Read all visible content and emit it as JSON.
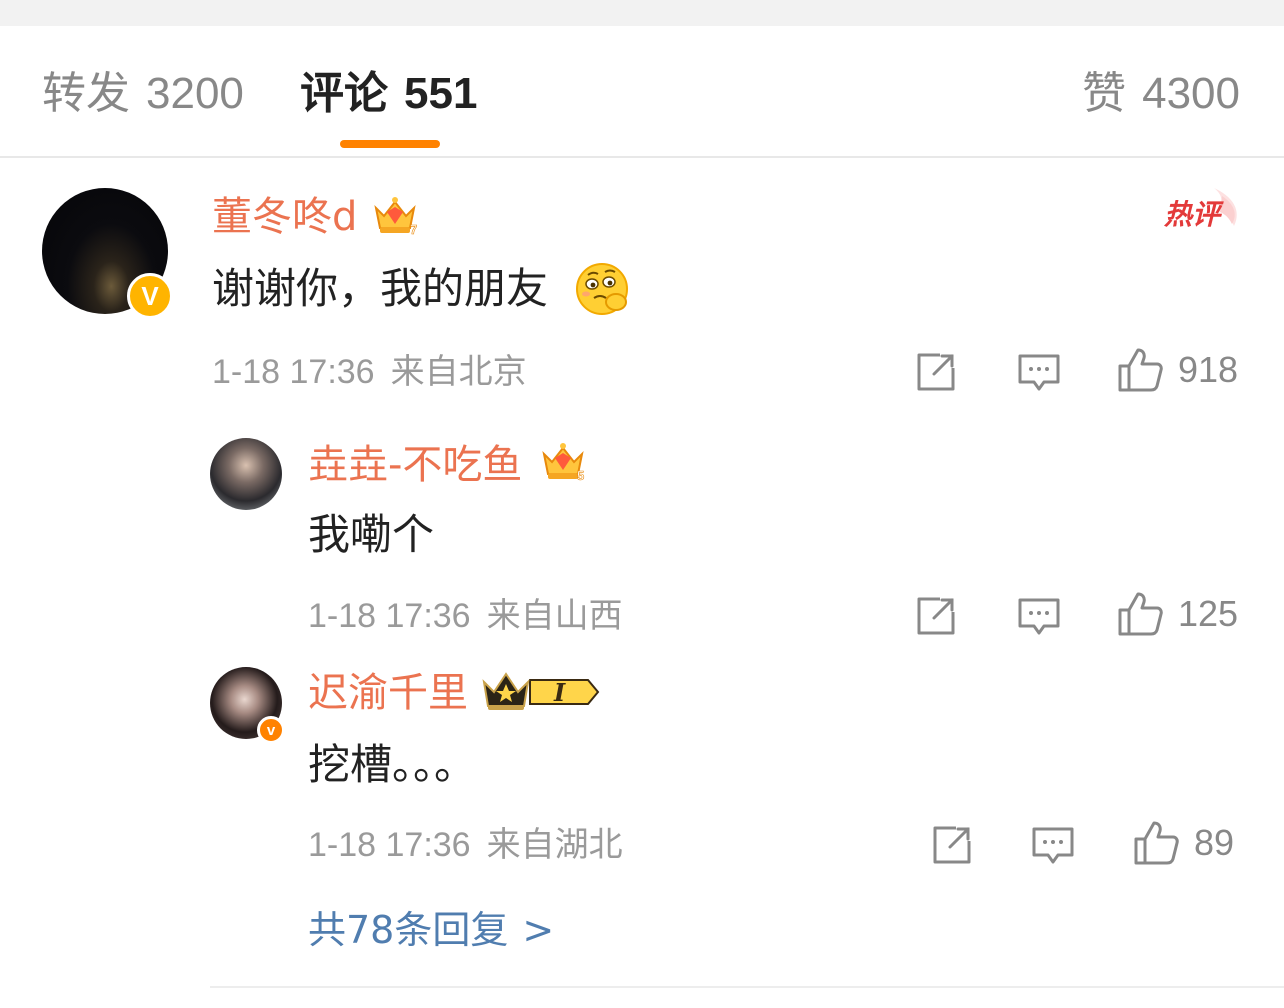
{
  "tabs": {
    "repost": {
      "label": "转发",
      "count": "3200"
    },
    "comments": {
      "label": "评论",
      "count": "551"
    },
    "likes": {
      "label": "赞",
      "count": "4300"
    }
  },
  "colors": {
    "accent": "#ff8200",
    "username": "#eb7350",
    "link": "#507daf",
    "meta": "#9a9a9a"
  },
  "hot_comment": {
    "tag": "热评",
    "username": "董冬咚d",
    "level_badge": "7",
    "text": "谢谢你，我的朋友",
    "emoji": "thinking-face-emoji",
    "time": "1-18 17:36",
    "location": "来自北京",
    "likes": "918"
  },
  "replies": [
    {
      "username": "垚垚-不吃鱼",
      "level_badge": "5",
      "text": "我嘞个",
      "time": "1-18 17:36",
      "location": "来自山西",
      "likes": "125"
    },
    {
      "username": "迟渝千里",
      "level_badge": "I",
      "text": "挖槽。。。",
      "time": "1-18 17:36",
      "location": "来自湖北",
      "likes": "89"
    }
  ],
  "more_replies": {
    "label": "共78条回复",
    "chevron": ">"
  }
}
